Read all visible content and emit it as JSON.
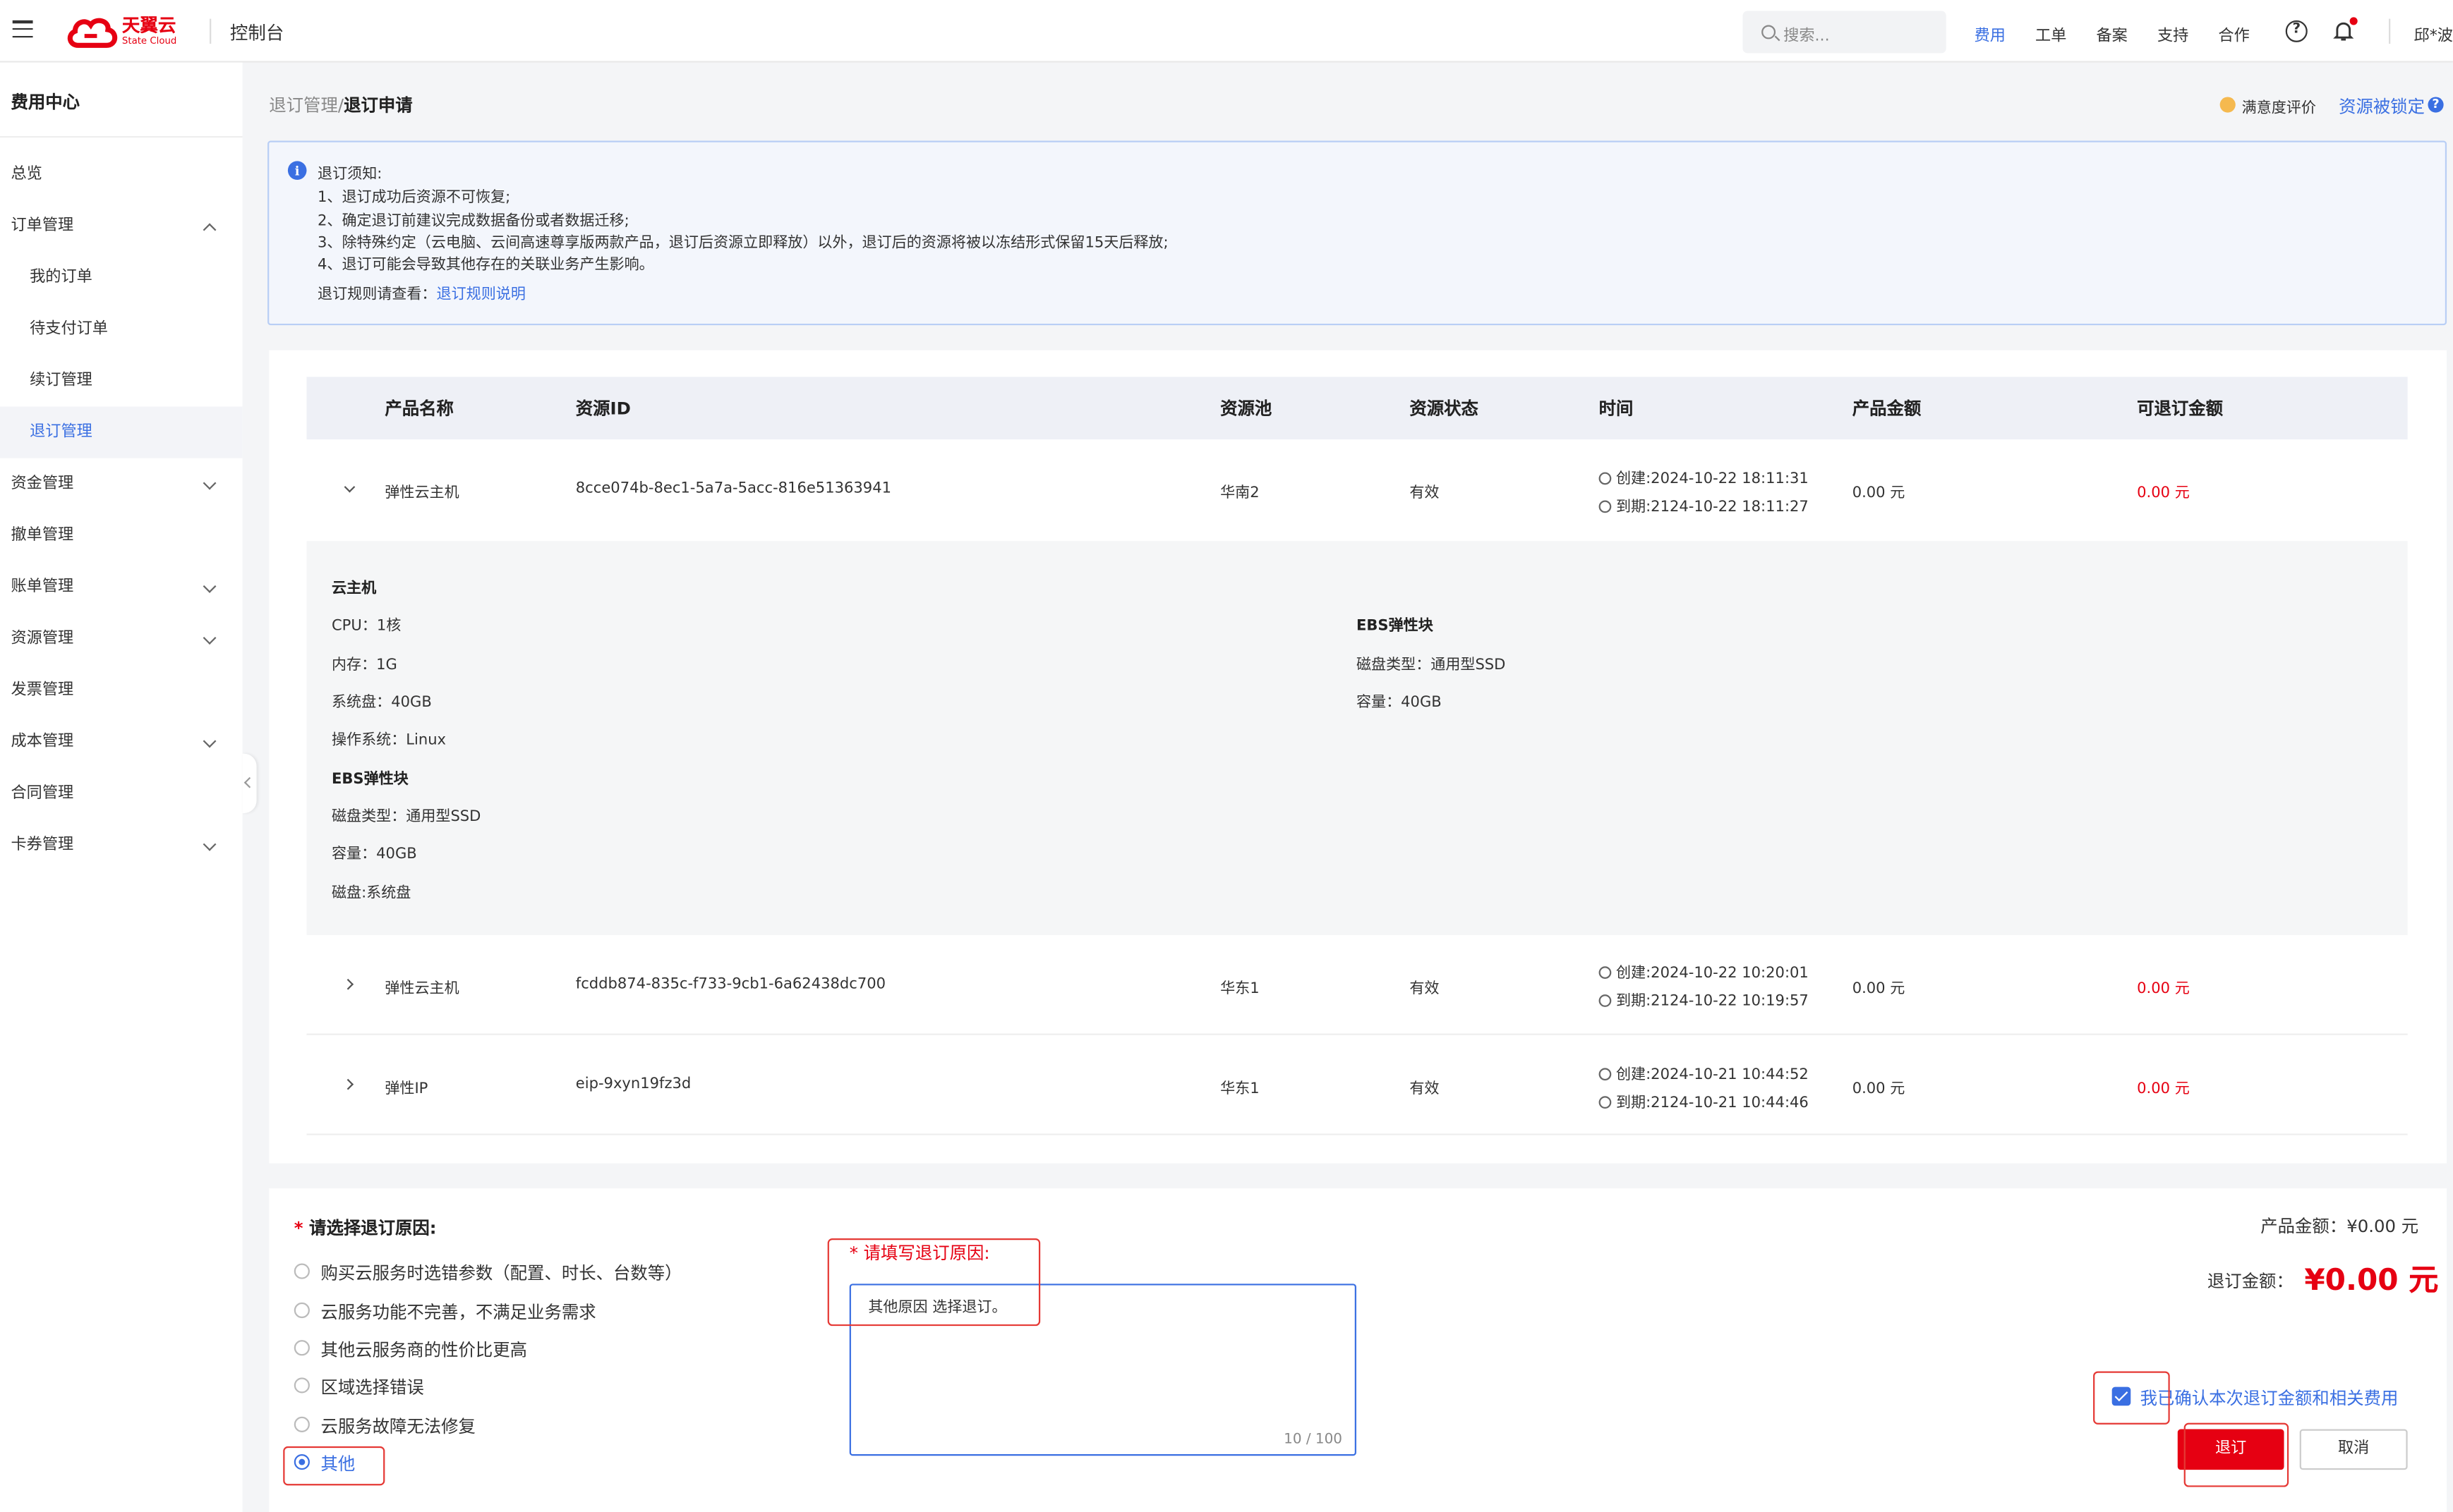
{
  "header": {
    "logo_text": "天翼云",
    "logo_sub": "State Cloud",
    "console": "控制台",
    "search_placeholder": "搜索...",
    "nav": [
      "费用",
      "工单",
      "备案",
      "支持",
      "合作"
    ],
    "help": "?",
    "user": "邱*波"
  },
  "sidebar": {
    "title": "费用中心",
    "items": [
      {
        "label": "总览"
      },
      {
        "label": "订单管理"
      },
      {
        "label": "我的订单"
      },
      {
        "label": "待支付订单"
      },
      {
        "label": "续订管理"
      },
      {
        "label": "退订管理"
      },
      {
        "label": "资金管理"
      },
      {
        "label": "撤单管理"
      },
      {
        "label": "账单管理"
      },
      {
        "label": "资源管理"
      },
      {
        "label": "发票管理"
      },
      {
        "label": "成本管理"
      },
      {
        "label": "合同管理"
      },
      {
        "label": "卡券管理"
      }
    ]
  },
  "breadcrumb": {
    "parent": "退订管理",
    "sep": "/",
    "current": "退订申请"
  },
  "top_actions": {
    "satisfaction": "满意度评价",
    "locked": "资源被锁定",
    "q": "?"
  },
  "notice": {
    "icon": "i",
    "lines": [
      "退订须知:",
      "1、退订成功后资源不可恢复;",
      "2、确定退订前建议完成数据备份或者数据迁移;",
      "3、除特殊约定（云电脑、云间高速尊享版两款产品，退订后资源立即释放）以外，退订后的资源将被以冻结形式保留15天后释放;",
      "4、退订可能会导致其他存在的关联业务产生影响。"
    ],
    "rules_prefix": "退订规则请查看：",
    "rules_link": "退订规则说明"
  },
  "table": {
    "headers": [
      "产品名称",
      "资源ID",
      "资源池",
      "资源状态",
      "时间",
      "产品金额",
      "可退订金额"
    ],
    "rows": [
      {
        "name": "弹性云主机",
        "id": "8cce074b-8ec1-5a7a-5acc-816e51363941",
        "pool": "华南2",
        "status": "有效",
        "created": "创建:2024-10-22 18:11:31",
        "expires": "到期:2124-10-22 18:11:27",
        "amount": "0.00 元",
        "refund": "0.00 元"
      },
      {
        "name": "弹性云主机",
        "id": "fcddb874-835c-f733-9cb1-6a62438dc700",
        "pool": "华东1",
        "status": "有效",
        "created": "创建:2024-10-22 10:20:01",
        "expires": "到期:2124-10-22 10:19:57",
        "amount": "0.00 元",
        "refund": "0.00 元"
      },
      {
        "name": "弹性IP",
        "id": "eip-9xyn19fz3d",
        "pool": "华东1",
        "status": "有效",
        "created": "创建:2024-10-21 10:44:52",
        "expires": "到期:2124-10-21 10:44:46",
        "amount": "0.00 元",
        "refund": "0.00 元"
      }
    ],
    "detail": {
      "left": [
        "云主机",
        "CPU：1核",
        "内存：1G",
        "系统盘：40GB",
        "操作系统：Linux",
        "EBS弹性块",
        "磁盘类型：通用型SSD",
        "容量：40GB",
        "磁盘:系统盘"
      ],
      "right": [
        "EBS弹性块",
        "磁盘类型：通用型SSD",
        "容量：40GB"
      ]
    }
  },
  "form": {
    "req_mark": "*",
    "reason_title": "请选择退订原因:",
    "reasons": [
      "购买云服务时选错参数（配置、时长、台数等）",
      "云服务功能不完善，不满足业务需求",
      "其他云服务商的性价比更高",
      "区域选择错误",
      "云服务故障无法修复",
      "其他"
    ],
    "selected_reason": 5,
    "fill_title": "* 请填写退订原因:",
    "textarea_value": "其他原因 选择退订。",
    "char_count": "10 / 100",
    "product_amount": "产品金额：¥0.00 元",
    "refund_label": "退订金额：",
    "refund_value": "¥0.00 元",
    "confirm_label": "我已确认本次退订金额和相关费用",
    "confirm_checked": true,
    "submit": "退订",
    "cancel": "取消"
  },
  "colors": {
    "accent": "#3a6fe2",
    "brand": "#e60012",
    "highlight": "#e53935"
  }
}
